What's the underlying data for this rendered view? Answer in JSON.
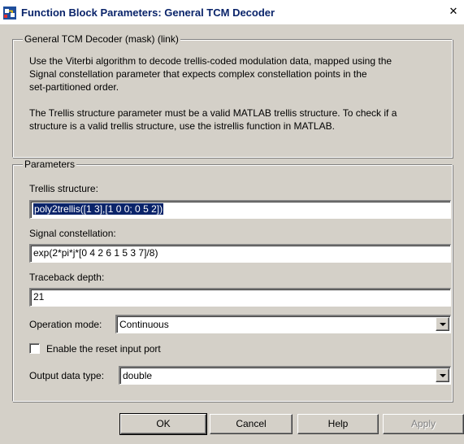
{
  "window": {
    "title": "Function Block Parameters: General TCM Decoder",
    "close_symbol": "✕"
  },
  "mask_group": {
    "label": "General TCM Decoder (mask) (link)",
    "description_lines": [
      "Use the Viterbi algorithm to decode trellis-coded modulation data, mapped using the",
      "Signal constellation parameter that expects complex constellation points in the",
      "set-partitioned order.",
      "",
      "The Trellis structure parameter must be a valid MATLAB trellis structure. To check if a",
      "structure is a valid trellis structure, use the istrellis function in MATLAB."
    ]
  },
  "parameters_group": {
    "label": "Parameters",
    "trellis_structure": {
      "label": "Trellis structure:",
      "value": "poly2trellis([1 3],[1 0 0; 0 5 2])"
    },
    "signal_constellation": {
      "label": "Signal constellation:",
      "value": "exp(2*pi*j*[0 4 2 6 1 5 3 7]/8)"
    },
    "traceback_depth": {
      "label": "Traceback depth:",
      "value": "21"
    },
    "operation_mode": {
      "label": "Operation mode:",
      "value": "Continuous"
    },
    "reset_input_port": {
      "label": "Enable the reset input port",
      "checked": false
    },
    "output_data_type": {
      "label": "Output data type:",
      "value": "double"
    }
  },
  "buttons": {
    "ok": "OK",
    "cancel": "Cancel",
    "help": "Help",
    "apply": "Apply"
  },
  "icons": {
    "app": "simulink-block-icon",
    "close": "close-icon",
    "dropdown": "chevron-down-icon"
  },
  "colors": {
    "dialog_bg": "#d4d0c8",
    "title_text": "#0a246a",
    "selection_bg": "#0a246a"
  }
}
